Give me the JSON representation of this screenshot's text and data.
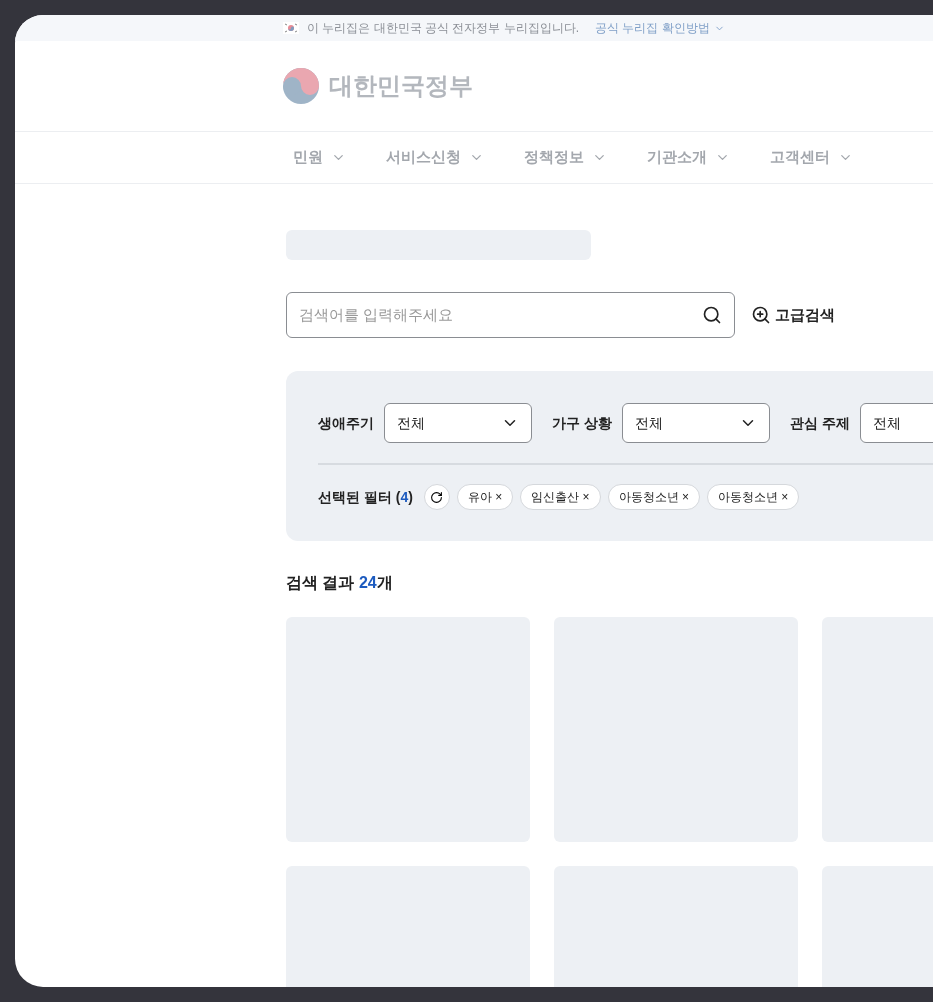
{
  "banner": {
    "text": "이 누리집은 대한민국 공식 전자정부 누리집입니다.",
    "link": "공식 누리집 확인방법"
  },
  "logo": {
    "text": "대한민국정부"
  },
  "nav": [
    {
      "label": "민원"
    },
    {
      "label": "서비스신청"
    },
    {
      "label": "정책정보"
    },
    {
      "label": "기관소개"
    },
    {
      "label": "고객센터"
    }
  ],
  "search": {
    "placeholder": "검색어를 입력해주세요",
    "advanced": "고급검색"
  },
  "filters": [
    {
      "label": "생애주기",
      "value": "전체"
    },
    {
      "label": "가구 상황",
      "value": "전체"
    },
    {
      "label": "관심 주제",
      "value": "전체"
    }
  ],
  "selected_filters": {
    "label": "선택된 필터 (",
    "count": "4",
    "close": ")",
    "chips": [
      "유아 ×",
      "임신출산 ×",
      "아동청소년 ×",
      "아동청소년 ×"
    ]
  },
  "results": {
    "label": "검색 결과 ",
    "count": "24",
    "unit": "개"
  },
  "cards": [
    {
      "kind": "skeleton"
    },
    {
      "kind": "skeleton"
    },
    {
      "kind": "skeleton"
    },
    {
      "kind": "skeleton"
    },
    {
      "kind": "skeleton"
    },
    {
      "kind": "skeleton"
    }
  ]
}
